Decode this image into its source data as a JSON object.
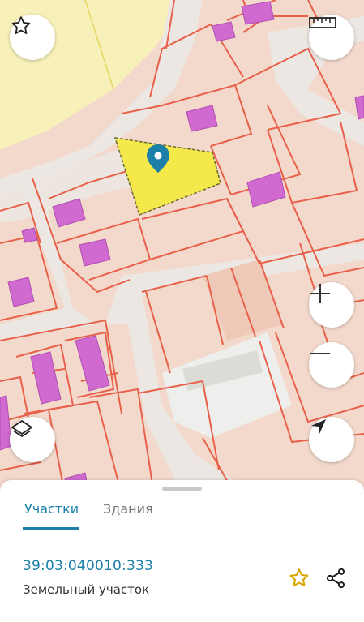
{
  "map": {
    "icons": {
      "favorite": "star-icon",
      "measure": "ruler-icon",
      "zoom_in": "plus-icon",
      "zoom_out": "minus-icon",
      "layers": "layers-icon",
      "location": "navigation-arrow-icon",
      "marker": "map-pin-icon"
    },
    "colors": {
      "background": "#f3d9cc",
      "parcel_border": "#e8604a",
      "building": "#d06ad0",
      "selected_parcel": "#f5e84a",
      "road": "#ece7e2",
      "zone": "#f7efb5",
      "marker": "#1b7fa8"
    }
  },
  "sheet": {
    "tabs": [
      {
        "label": "Участки",
        "active": true
      },
      {
        "label": "Здания",
        "active": false
      }
    ],
    "result": {
      "cadastral_number": "39:03:040010:333",
      "type": "Земельный участок"
    },
    "actions": {
      "favorite_icon": "star-outline-icon",
      "share_icon": "share-icon"
    },
    "accent_color": "#1b7fa8",
    "favorite_color": "#d9a800"
  }
}
